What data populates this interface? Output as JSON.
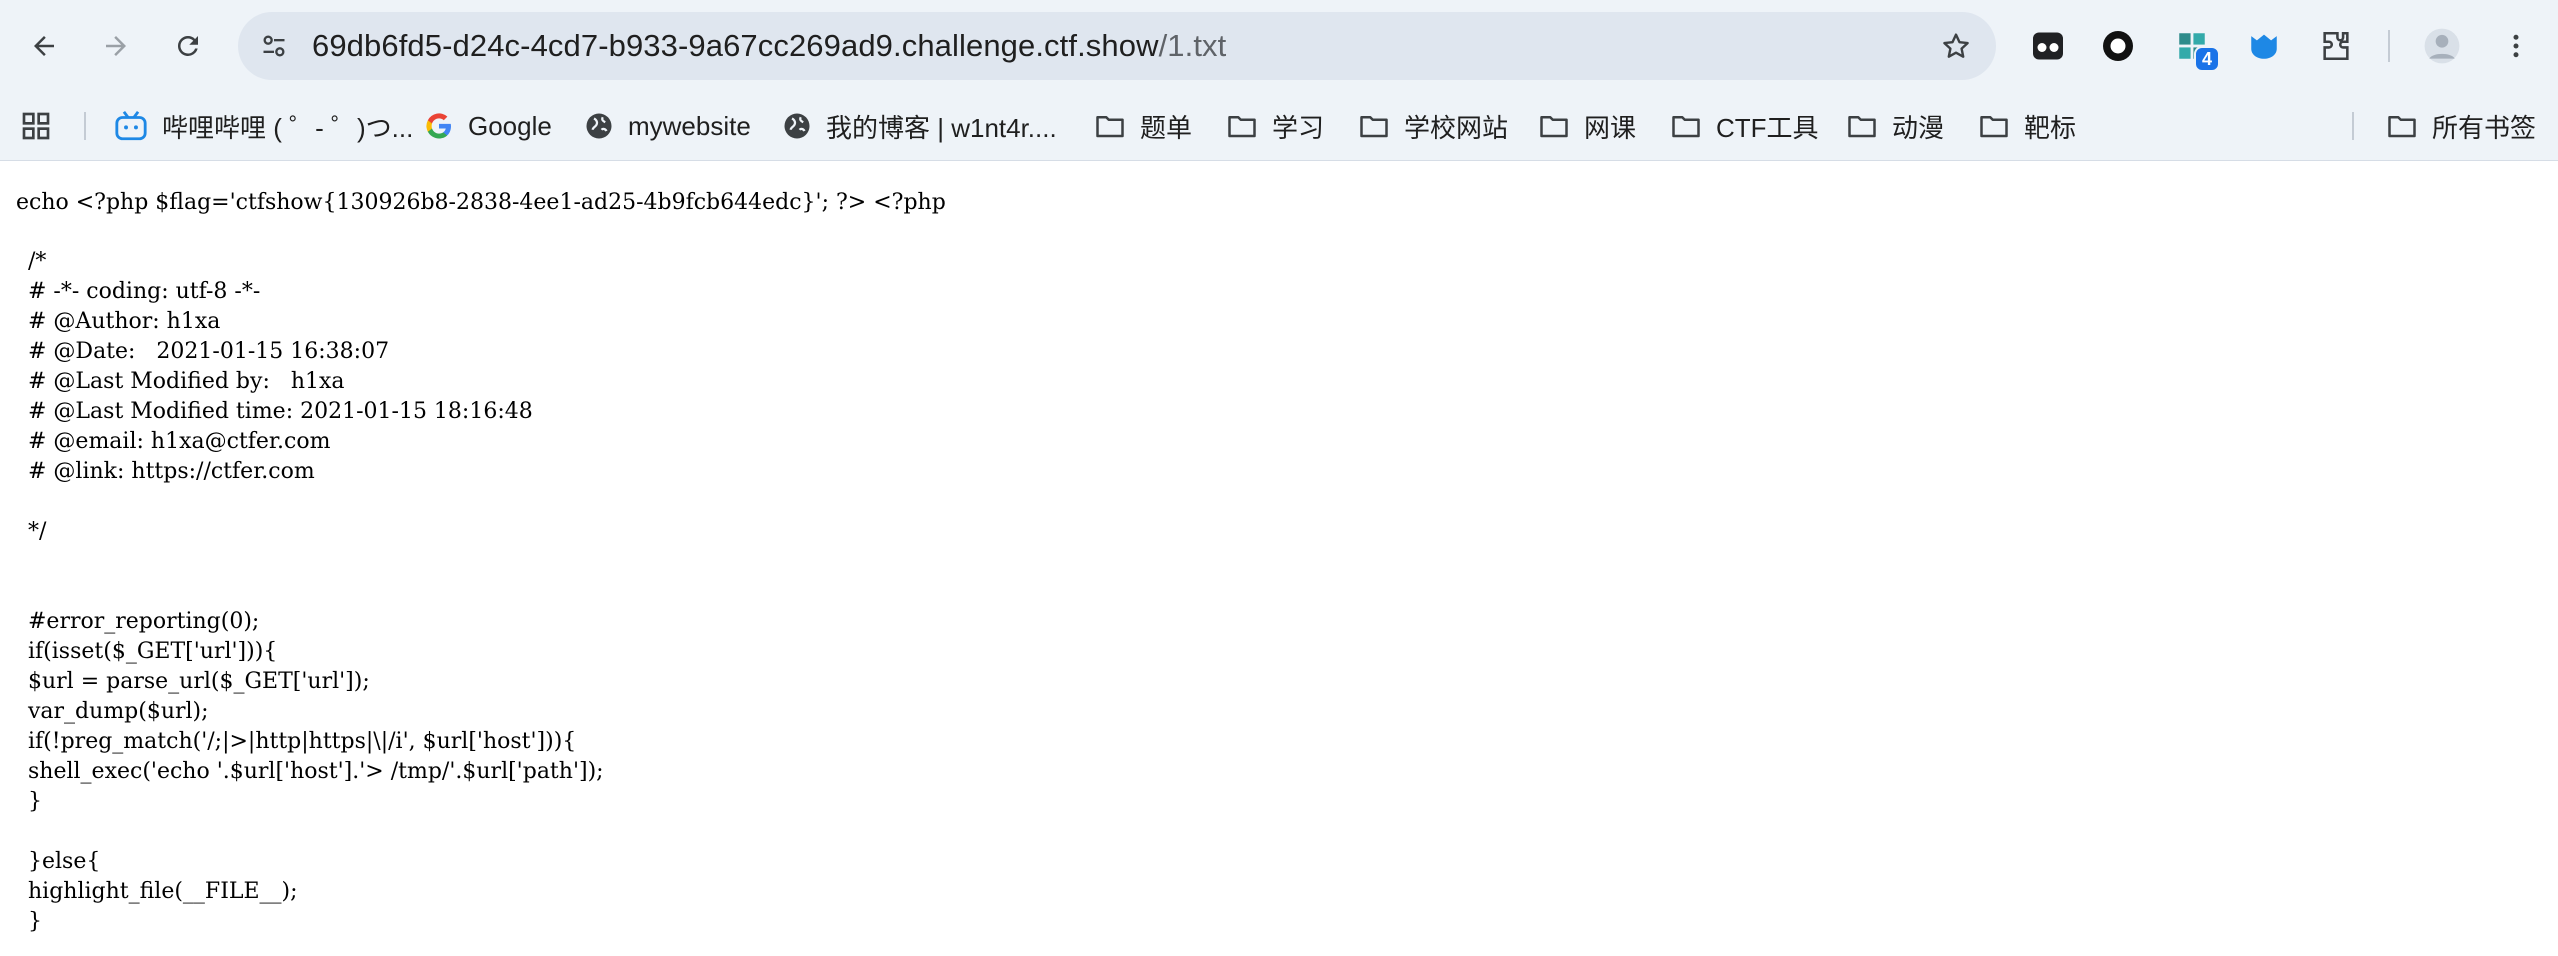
{
  "browser": {
    "url_host": "69db6fd5-d24c-4cd7-b933-9a67cc269ad9.challenge.ctf.show",
    "url_path": "/1.txt",
    "extension_badge": "4",
    "icons": [
      "back-icon",
      "forward-icon",
      "reload-icon",
      "site-settings-icon",
      "star-icon",
      "extension-icon",
      "puzzle-icon",
      "profile-icon",
      "menu-icon"
    ]
  },
  "bookmarks": [
    {
      "label": "哔哩哔哩 ( ゜- ゜)つ...",
      "icon": "bilibili-icon"
    },
    {
      "label": "Google",
      "icon": "google-icon"
    },
    {
      "label": "mywebsite",
      "icon": "globe-icon"
    },
    {
      "label": "我的博客 | w1nt4r....",
      "icon": "globe-icon"
    },
    {
      "label": "题单",
      "icon": "folder-icon"
    },
    {
      "label": "学习",
      "icon": "folder-icon"
    },
    {
      "label": "学校网站",
      "icon": "folder-icon"
    },
    {
      "label": "网课",
      "icon": "folder-icon"
    },
    {
      "label": "CTF工具",
      "icon": "folder-icon"
    },
    {
      "label": "动漫",
      "icon": "folder-icon"
    },
    {
      "label": "靶标",
      "icon": "folder-icon"
    }
  ],
  "all_bookmarks_label": "所有书签",
  "page": {
    "first_line": "echo <?php $flag='ctfshow{130926b8-2838-4ee1-ad25-4b9fcb644edc}'; ?> <?php",
    "lines": [
      "/*",
      "# -*- coding: utf-8 -*-",
      "# @Author: h1xa",
      "# @Date:   2021-01-15 16:38:07",
      "# @Last Modified by:   h1xa",
      "# @Last Modified time: 2021-01-15 18:16:48",
      "# @email: h1xa@ctfer.com",
      "# @link: https://ctfer.com",
      "",
      "*/",
      "",
      "",
      "#error_reporting(0);",
      "if(isset($_GET['url'])){",
      "$url = parse_url($_GET['url']);",
      "var_dump($url);",
      "if(!preg_match('/;|>|http|https|\\|/i', $url['host'])){",
      "shell_exec('echo '.$url['host'].'> /tmp/'.$url['path']);",
      "}",
      "",
      "}else{",
      "highlight_file(__FILE__);",
      "}"
    ]
  }
}
